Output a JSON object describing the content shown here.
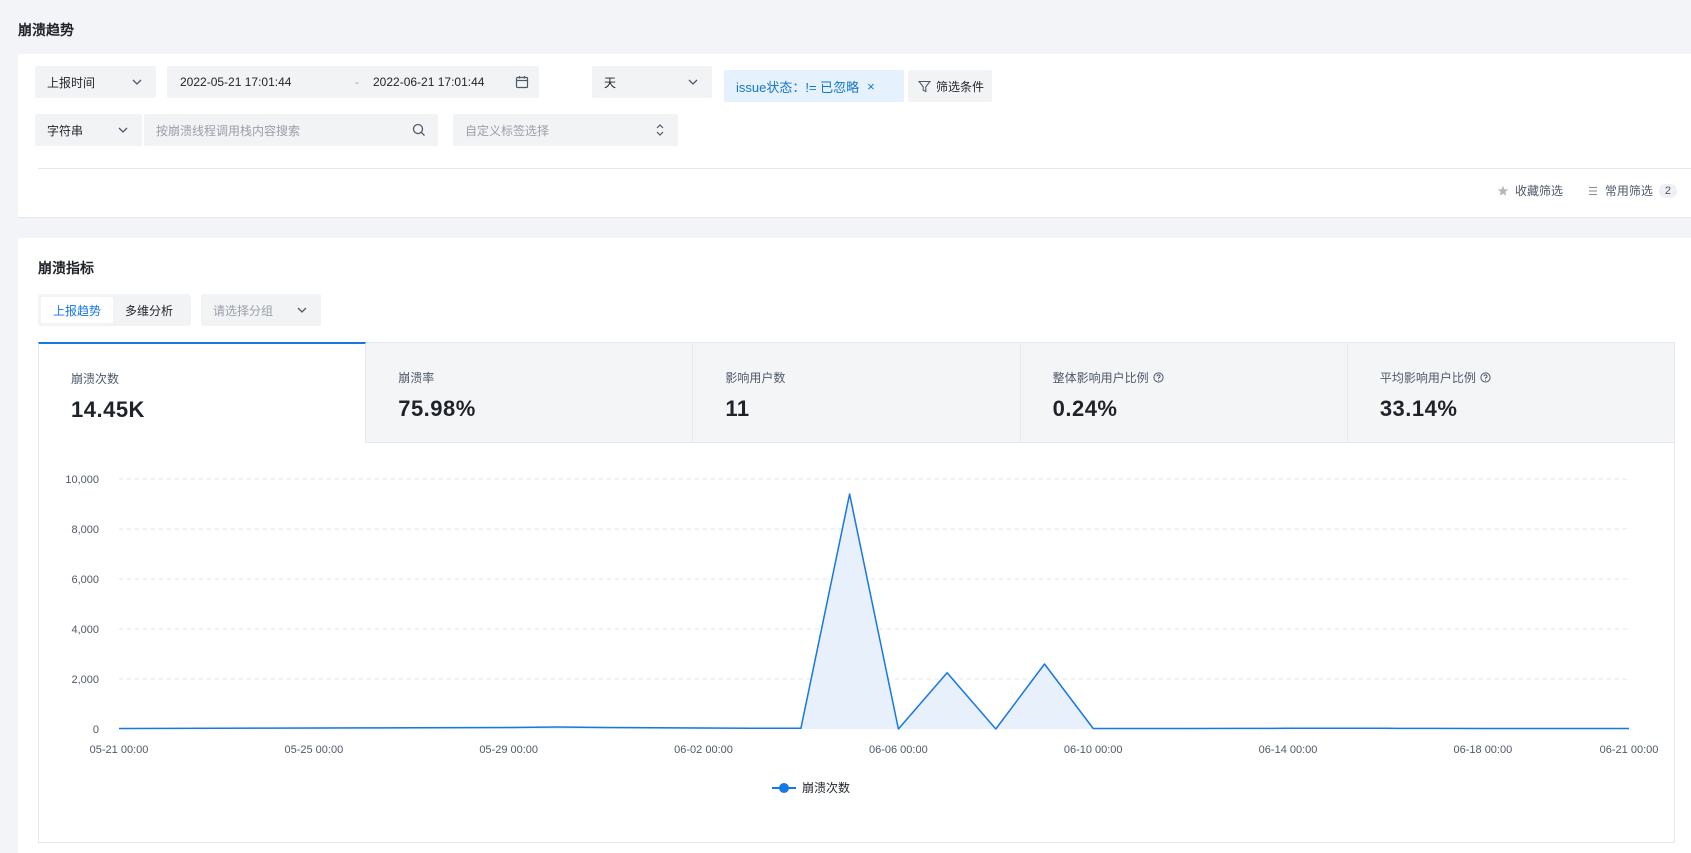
{
  "page": {
    "title": "崩溃趋势"
  },
  "filters": {
    "time_type": "上报时间",
    "date_start": "2022-05-21 17:01:44",
    "date_sep": "-",
    "date_end": "2022-06-21 17:01:44",
    "granularity": "天",
    "issue_tag": "issue状态：!= 已忽略",
    "issue_tag_close": "×",
    "filter_btn": "筛选条件",
    "search_type": "字符串",
    "search_placeholder": "按崩溃线程调用栈内容搜索",
    "tag_placeholder": "自定义标签选择",
    "favorite": "收藏筛选",
    "common": "常用筛选",
    "common_count": "2"
  },
  "metrics": {
    "title": "崩溃指标",
    "tabs": [
      "上报趋势",
      "多维分析"
    ],
    "group_placeholder": "请选择分组",
    "cards": [
      {
        "label": "崩溃次数",
        "value": "14.45K",
        "help": false
      },
      {
        "label": "崩溃率",
        "value": "75.98%",
        "help": false
      },
      {
        "label": "影响用户数",
        "value": "11",
        "help": false
      },
      {
        "label": "整体影响用户比例",
        "value": "0.24%",
        "help": true
      },
      {
        "label": "平均影响用户比例",
        "value": "33.14%",
        "help": true
      }
    ]
  },
  "colors": {
    "accent": "#1677e5",
    "area": "#e4eefb"
  },
  "chart_data": {
    "type": "area",
    "ylim": [
      0,
      10000
    ],
    "y_ticks": [
      "0",
      "2,000",
      "4,000",
      "6,000",
      "8,000",
      "10,000"
    ],
    "x_tick_labels": [
      "05-21 00:00",
      "05-25 00:00",
      "05-29 00:00",
      "06-02 00:00",
      "06-06 00:00",
      "06-10 00:00",
      "06-14 00:00",
      "06-18 00:00",
      "06-21 00:00"
    ],
    "x_tick_days": [
      0,
      4,
      8,
      12,
      16,
      20,
      24,
      28,
      31
    ],
    "series": [
      {
        "name": "崩溃次数",
        "x_days": [
          0,
          1,
          2,
          3,
          4,
          5,
          6,
          7,
          8,
          9,
          10,
          11,
          12,
          13,
          14,
          15,
          16,
          17,
          18,
          19,
          20,
          21,
          22,
          23,
          24,
          25,
          26,
          27,
          28,
          29,
          30,
          31
        ],
        "values": [
          20,
          25,
          30,
          35,
          40,
          45,
          50,
          55,
          60,
          80,
          60,
          50,
          40,
          30,
          30,
          9400,
          0,
          2250,
          0,
          2600,
          20,
          20,
          20,
          25,
          30,
          30,
          30,
          25,
          20,
          20,
          20,
          20
        ]
      }
    ],
    "legend": "bottom-center",
    "grid": true
  }
}
